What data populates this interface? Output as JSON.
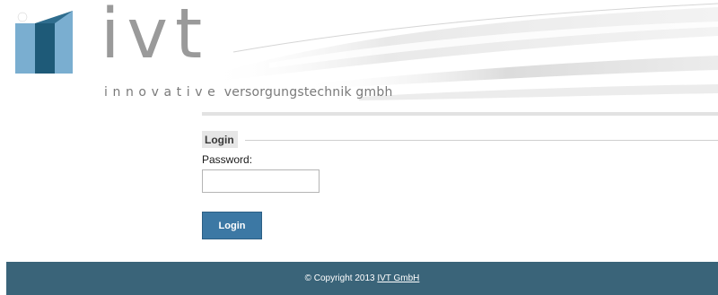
{
  "header": {
    "logo_word": "ivt",
    "tagline_spaced": "innovative",
    "tagline_rest": "versorgungstechnik gmbh"
  },
  "login": {
    "legend": "Login",
    "password_label": "Password:",
    "password_value": "",
    "submit_label": "Login"
  },
  "footer": {
    "copyright_prefix": "© Copyright 2013",
    "company_link": "IVT GmbH"
  },
  "colors": {
    "logo_dark_blue": "#1e5a78",
    "logo_light_blue": "#7aaed0",
    "button_blue": "#3c78a4",
    "footer_bg": "#3a6479"
  }
}
